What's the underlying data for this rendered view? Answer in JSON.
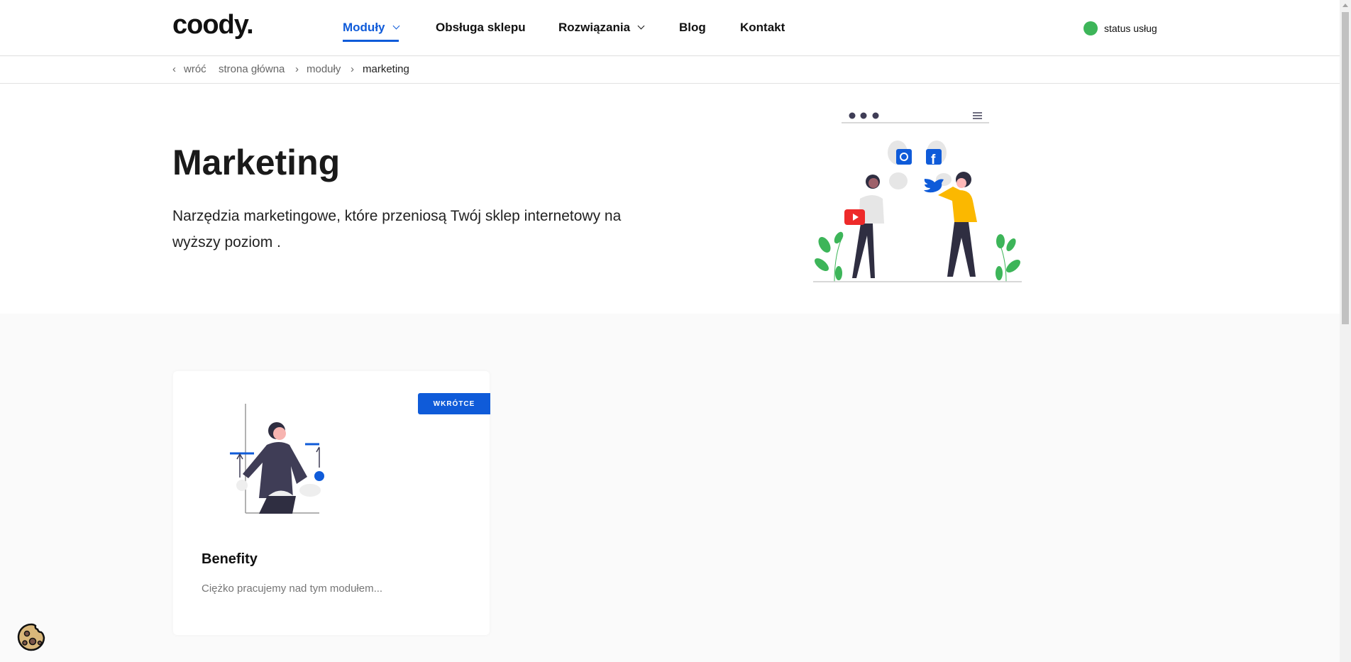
{
  "header": {
    "logo": "coody.",
    "nav": [
      {
        "label": "Moduły",
        "active": true,
        "dropdown": true
      },
      {
        "label": "Obsługa sklepu"
      },
      {
        "label": "Rozwiązania",
        "dropdown": true
      },
      {
        "label": "Blog"
      },
      {
        "label": "Kontakt"
      }
    ],
    "status_label": "status usług",
    "status_color": "#3db559",
    "accent": "#0f5bd9"
  },
  "breadcrumb": {
    "back": "wróć",
    "items": [
      "strona główna",
      "moduły",
      "marketing"
    ]
  },
  "hero": {
    "title": "Marketing",
    "description": "Narzędzia marketingowe, które przeniosą Twój sklep internetowy na wyższy poziom ."
  },
  "modules": [
    {
      "badge": "WKRÓTCE",
      "title": "Benefity",
      "description": "Ciężko pracujemy nad tym modułem..."
    }
  ],
  "icons": [
    "cookie-icon",
    "instagram-icon",
    "facebook-icon",
    "twitter-icon",
    "youtube-icon"
  ]
}
